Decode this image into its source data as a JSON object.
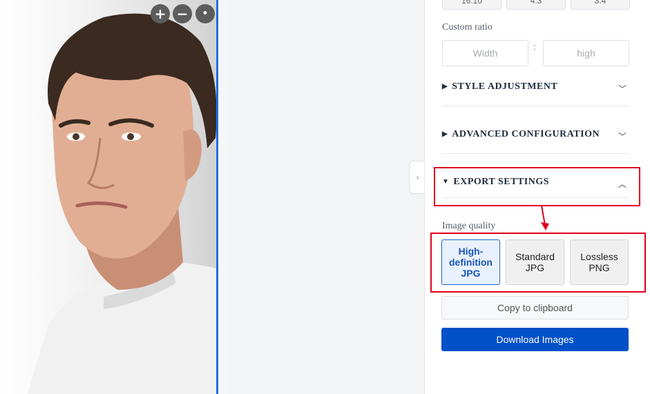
{
  "preview": {
    "zoom_in": "+",
    "zoom_out": "−",
    "reset": "•"
  },
  "canvas": {
    "collapse_glyph": "›"
  },
  "panel": {
    "ratio_buttons": [
      "16:10",
      "4:3",
      "3:4"
    ],
    "custom_ratio_label": "Custom ratio",
    "width_placeholder": "Width",
    "height_placeholder": "high",
    "ratio_separator": ":",
    "sections": {
      "style": {
        "title": "STYLE ADJUSTMENT",
        "marker": "▶",
        "chevron": "﹀"
      },
      "advanced": {
        "title": "ADVANCED CONFIGURATION",
        "marker": "▶",
        "chevron": "﹀"
      },
      "export": {
        "title": "EXPORT SETTINGS",
        "marker": "▼",
        "chevron": "︿"
      }
    },
    "image_quality_label": "Image quality",
    "quality_options": [
      "High-definition JPG",
      "Standard JPG",
      "Lossless PNG"
    ],
    "selected_quality": "High-definition JPG",
    "copy_label": "Copy to clipboard",
    "download_label": "Download Images"
  },
  "colors": {
    "accent": "#0050c8",
    "selected": "#1e64d0",
    "annotation": "#e0001b"
  }
}
